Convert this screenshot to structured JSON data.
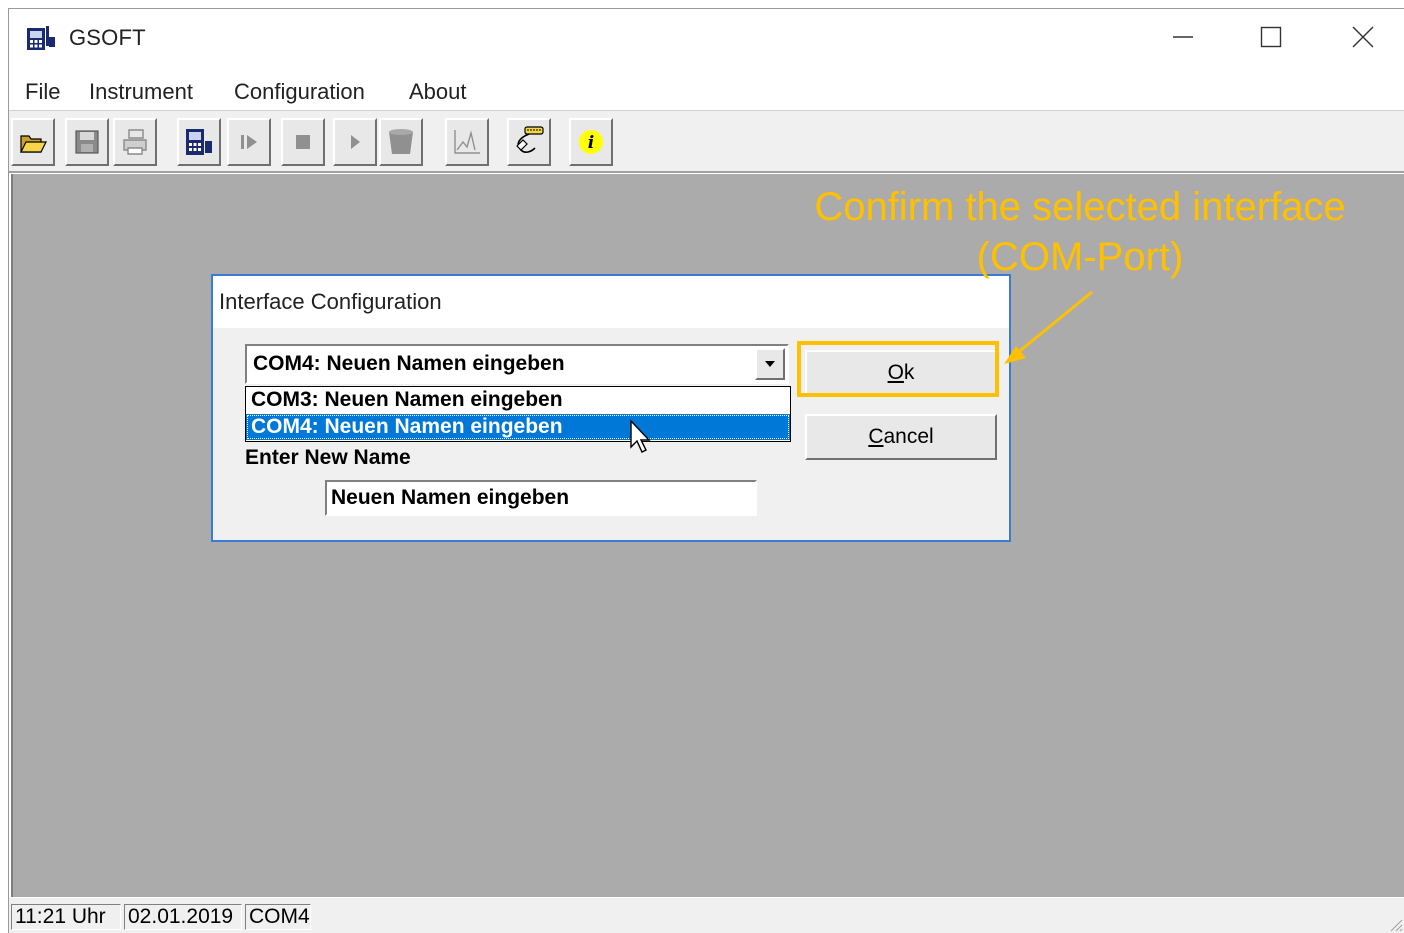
{
  "window": {
    "title": "GSOFT",
    "icons": {
      "app": "device-icon",
      "minimize": "minimize-icon",
      "maximize": "maximize-icon",
      "close": "close-icon"
    }
  },
  "menu": {
    "items": [
      {
        "label": "File"
      },
      {
        "label": "Instrument"
      },
      {
        "label": "Configuration"
      },
      {
        "label": "About"
      }
    ]
  },
  "toolbar": {
    "buttons": [
      {
        "icon": "open-folder-icon"
      },
      {
        "icon": "save-icon"
      },
      {
        "icon": "print-icon"
      },
      {
        "icon": "instrument-icon"
      },
      {
        "icon": "step-play-icon"
      },
      {
        "icon": "stop-icon"
      },
      {
        "icon": "play-icon"
      },
      {
        "icon": "container-icon"
      },
      {
        "icon": "chart-icon"
      },
      {
        "icon": "interface-cable-icon"
      },
      {
        "icon": "info-icon"
      }
    ]
  },
  "annotation": {
    "text": "Confirm the selected interface (COM-Port)",
    "color": "#ffc000"
  },
  "dialog": {
    "title": "Interface Configuration",
    "combo_value": "COM4: Neuen Namen eingeben",
    "options": [
      "COM3: Neuen Namen eingeben",
      "COM4: Neuen Namen eingeben"
    ],
    "selected_index": 1,
    "new_name_label": "Enter New Name",
    "new_name_value": "Neuen Namen eingeben",
    "ok_label": "Ok",
    "ok_mnemonic": "O",
    "ok_rest": "k",
    "cancel_label": "Cancel",
    "cancel_mnemonic": "C",
    "cancel_rest": "ancel"
  },
  "statusbar": {
    "time": "11:21 Uhr",
    "date": "02.01.2019",
    "port": "COM4"
  },
  "colors": {
    "selection": "#0078d7",
    "client_bg": "#ababab",
    "annotation": "#ffc000"
  }
}
